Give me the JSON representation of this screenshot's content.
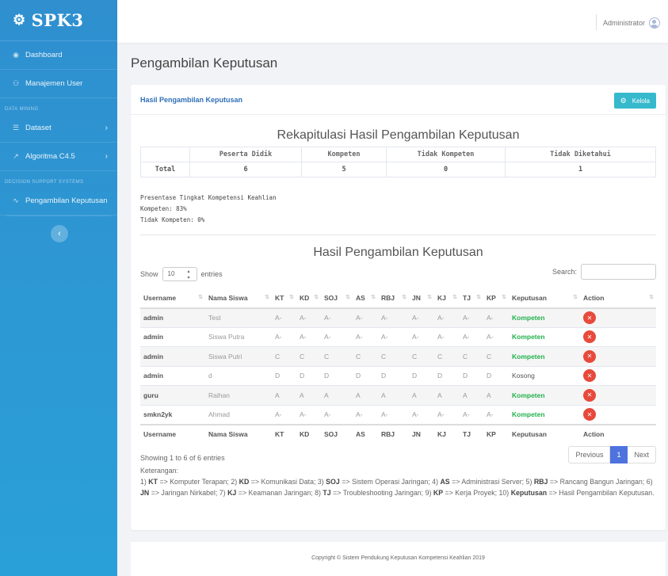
{
  "brand": {
    "name": "SPK3",
    "logo_icon": "gears-icon"
  },
  "sidebar": {
    "dashboard": "Dashboard",
    "manajemen_user": "Manajemen User",
    "heading_data_mining": "DATA MINING",
    "dataset": "Dataset",
    "algoritma": "Algoritma C4.5",
    "heading_dss": "DECISION SUPPORT SYSTEMS",
    "pengambilan": "Pengambilan Keputusan"
  },
  "topbar": {
    "user": "Administrator"
  },
  "page_title": "Pengambilan Keputusan",
  "card": {
    "title": "Hasil Pengambilan Keputusan",
    "kelola_label": "Kelola"
  },
  "rekap": {
    "title": "Rekapitulasi Hasil Pengambilan Keputusan",
    "headers": [
      "",
      "Peserta Didik",
      "Kompeten",
      "Tidak Kompeten",
      "Tidak Diketahui"
    ],
    "row": [
      "Total",
      "6",
      "5",
      "0",
      "1"
    ]
  },
  "presentase": {
    "heading": "Presentase Tingkat Kompetensi Keahlian",
    "kompeten": "Kompeten: 83%",
    "tidak_kompeten": "Tidak Kompeten: 0%"
  },
  "hasil": {
    "title": "Hasil Pengambilan Keputusan",
    "show_label": "Show",
    "entries_label": "entries",
    "page_size": "10",
    "search_label": "Search:",
    "columns": [
      "Username",
      "Nama Siswa",
      "KT",
      "KD",
      "SOJ",
      "AS",
      "RBJ",
      "JN",
      "KJ",
      "TJ",
      "KP",
      "Keputusan",
      "Action"
    ],
    "rows": [
      {
        "username": "admin",
        "nama": "Test",
        "grades": [
          "A-",
          "A-",
          "A-",
          "A-",
          "A-",
          "A-",
          "A-",
          "A-",
          "A-"
        ],
        "keputusan": "Kompeten"
      },
      {
        "username": "admin",
        "nama": "Siswa Putra",
        "grades": [
          "A-",
          "A-",
          "A-",
          "A-",
          "A-",
          "A-",
          "A-",
          "A-",
          "A-"
        ],
        "keputusan": "Kompeten"
      },
      {
        "username": "admin",
        "nama": "Siswa Putri",
        "grades": [
          "C",
          "C",
          "C",
          "C",
          "C",
          "C",
          "C",
          "C",
          "C"
        ],
        "keputusan": "Kompeten"
      },
      {
        "username": "admin",
        "nama": "d",
        "grades": [
          "D",
          "D",
          "D",
          "D",
          "D",
          "D",
          "D",
          "D",
          "D"
        ],
        "keputusan": "Kosong"
      },
      {
        "username": "guru",
        "nama": "Raihan",
        "grades": [
          "A",
          "A",
          "A",
          "A",
          "A",
          "A",
          "A",
          "A",
          "A"
        ],
        "keputusan": "Kompeten"
      },
      {
        "username": "smkn2yk",
        "nama": "Ahmad",
        "grades": [
          "A-",
          "A-",
          "A-",
          "A-",
          "A-",
          "A-",
          "A-",
          "A-",
          "A-"
        ],
        "keputusan": "Kompeten"
      }
    ],
    "info": "Showing 1 to 6 of 6 entries",
    "pager": {
      "previous": "Previous",
      "current": "1",
      "next": "Next"
    }
  },
  "keterangan": {
    "label": "Keterangan:",
    "items": [
      {
        "num": "1)",
        "abbr": "KT",
        "desc": "Komputer Terapan;"
      },
      {
        "num": "2)",
        "abbr": "KD",
        "desc": "Komunikasi Data;"
      },
      {
        "num": "3)",
        "abbr": "SOJ",
        "desc": "Sistem Operasi Jaringan;"
      },
      {
        "num": "4)",
        "abbr": "AS",
        "desc": "Administrasi Server;"
      },
      {
        "num": "5)",
        "abbr": "RBJ",
        "desc": "Rancang Bangun Jaringan;"
      },
      {
        "num": "6)",
        "abbr": "JN",
        "desc": "Jaringan Nirkabel;"
      },
      {
        "num": "7)",
        "abbr": "KJ",
        "desc": "Keamanan Jaringan;"
      },
      {
        "num": "8)",
        "abbr": "TJ",
        "desc": "Troubleshooting Jaringan;"
      },
      {
        "num": "9)",
        "abbr": "KP",
        "desc": "Kerja Proyek;"
      },
      {
        "num": "10)",
        "abbr": "Keputusan",
        "desc": "Hasil Pengambilan Keputusan."
      }
    ]
  },
  "footer": "Copyright © Sistem Pendukung Keputusan Kompetensi Keahlian 2019",
  "colors": {
    "sidebar": "#2f8fcf",
    "kompeten": "#23b14d",
    "delete": "#e74a3b",
    "kelola": "#36b9cc",
    "pager_active": "#4e73df"
  }
}
